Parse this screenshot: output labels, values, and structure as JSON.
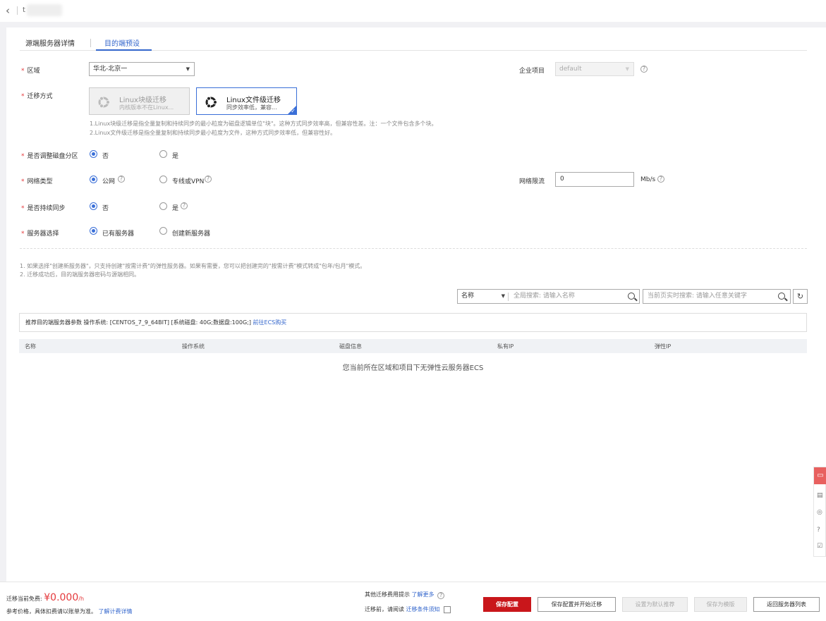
{
  "topbar": {
    "back_icon": "chevron-left-icon",
    "title": "t"
  },
  "tabs": [
    {
      "label": "源端服务器详情"
    },
    {
      "label": "目的端预设"
    }
  ],
  "form": {
    "region": {
      "label": "区域",
      "value": "华北-北京一"
    },
    "enterprise": {
      "label": "企业项目",
      "value": "default"
    },
    "migration": {
      "label": "迁移方式",
      "options": [
        {
          "title": "Linux块级迁移",
          "desc": "内核版本不在Linux..."
        },
        {
          "title": "Linux文件级迁移",
          "desc": "同步效率低，兼容..."
        }
      ],
      "notes": [
        "1.Linux块级迁移是指全量复制和持续同步的最小粒度为磁盘逻辑单位\"块\"。这种方式同步效率高，但兼容性差。注：一个文件包含多个块。",
        "2.Linux文件级迁移是指全量复制和持续同步最小粒度为文件，这种方式同步效率低，但兼容性好。"
      ]
    },
    "partition": {
      "label": "是否调整磁盘分区",
      "opt_no": "否",
      "opt_yes": "是"
    },
    "network": {
      "label": "网络类型",
      "opt_public": "公网",
      "opt_vpn": "专线或VPN"
    },
    "bandwidth": {
      "label": "网络限流",
      "value": "0",
      "unit": "Mb/s"
    },
    "sync": {
      "label": "是否持续同步",
      "opt_no": "否",
      "opt_yes": "是"
    },
    "server": {
      "label": "服务器选择",
      "opt_existing": "已有服务器",
      "opt_new": "创建新服务器"
    }
  },
  "tips": [
    "1. 如果选择\"创建新服务器\"，只支持创建\"按需计费\"的弹性服务器。如果有需要，您可以把创建完的\"按需计费\"模式转成\"包年/包月\"模式。",
    "2. 迁移成功后，目的端服务器密码与源端相同。"
  ],
  "search": {
    "field": "名称",
    "global_label": "全局搜索:",
    "global_placeholder": "请输入名称",
    "page_label": "当前页实时搜索:",
    "page_placeholder": "请输入任意关键字"
  },
  "recommend": {
    "text": "推荐目的端服务器参数 操作系统: [CENTOS_7_9_64BIT] [系统磁盘: 40G;数据盘:100G;]",
    "link": "前往ECS购买"
  },
  "table": {
    "columns": [
      "名称",
      "操作系统",
      "磁盘信息",
      "私有IP",
      "弹性IP"
    ],
    "empty": "您当前所在区域和项目下无弹性云服务器ECS"
  },
  "footer": {
    "fee_label": "迁移当前免费:",
    "price": "¥0.000",
    "price_unit": "/h",
    "ref_text": "参考价格，具体扣费请以账单为准。",
    "ref_link": "了解计费详情",
    "other_tip": "其他迁移费用提示",
    "other_link": "了解更多",
    "read_text": "迁移前，请阅读",
    "read_link": "迁移条件须知",
    "buttons": {
      "save": "保存配置",
      "save_start": "保存配置并开始迁移",
      "set_default": "设置为默认推荐",
      "save_template": "保存为模版",
      "back_list": "返回服务器列表"
    }
  },
  "colors": {
    "accent": "#3366cc",
    "primary_button": "#c9161b",
    "required": "#e4393c"
  }
}
